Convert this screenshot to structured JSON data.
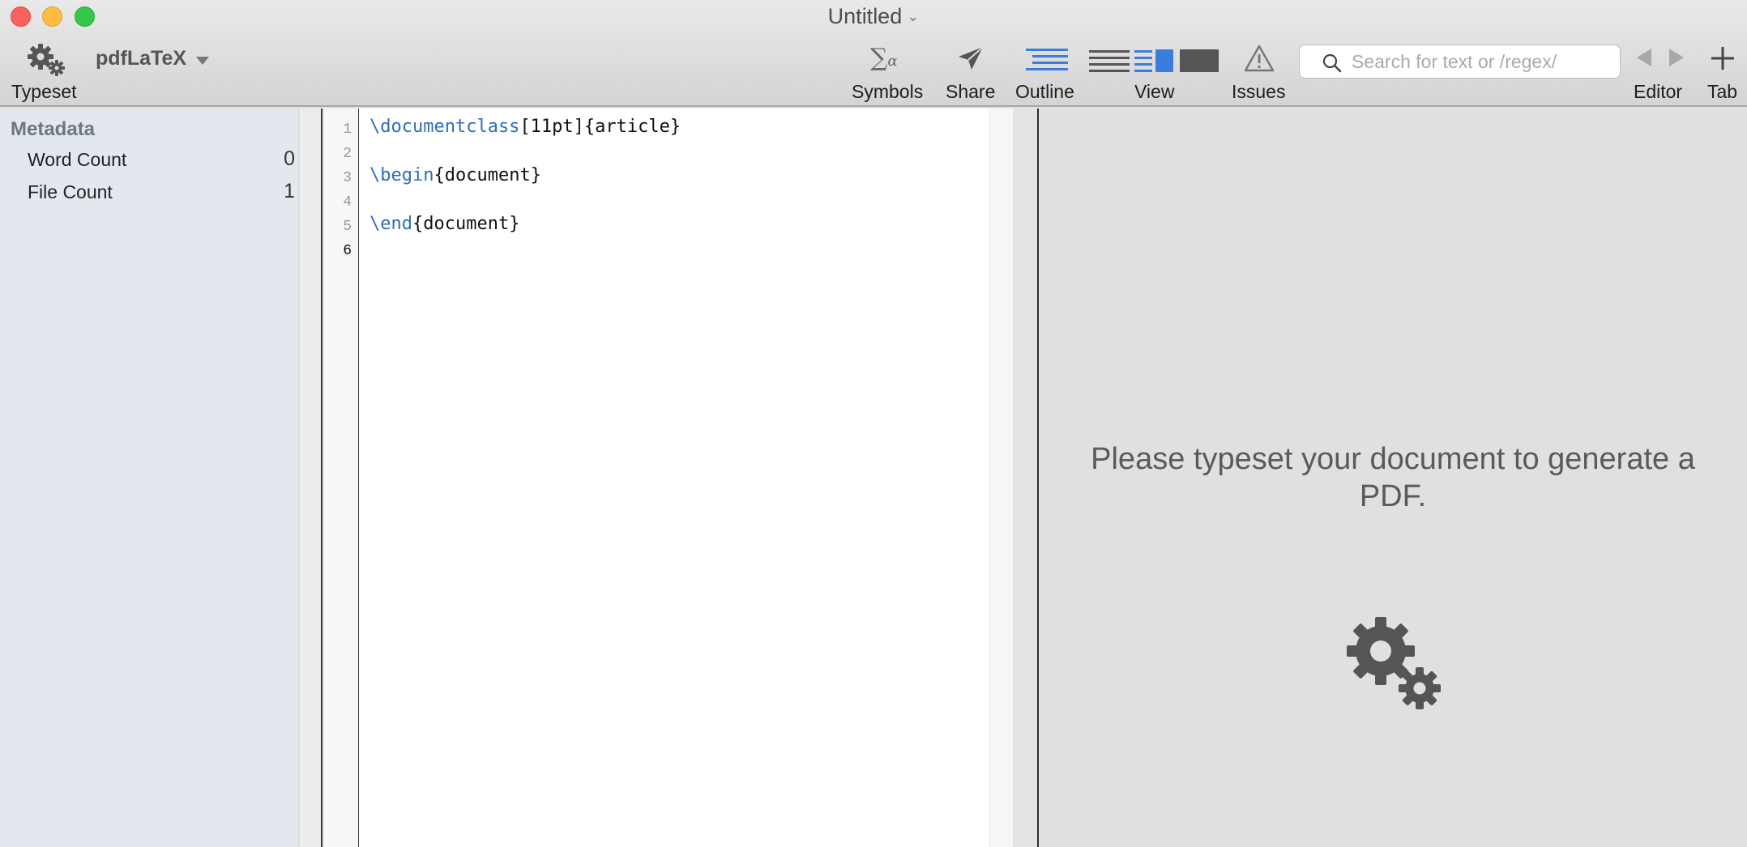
{
  "window": {
    "title": "Untitled"
  },
  "toolbar": {
    "typeset_label": "Typeset",
    "engine": "pdfLaTeX",
    "symbols_label": "Symbols",
    "share_label": "Share",
    "outline_label": "Outline",
    "view_label": "View",
    "issues_label": "Issues",
    "search_placeholder": "Search for text or /regex/",
    "editor_label": "Editor",
    "tab_label": "Tab",
    "accent_color": "#3b7ddd"
  },
  "sidebar": {
    "header": "Metadata",
    "rows": [
      {
        "label": "Word Count",
        "value": "0"
      },
      {
        "label": "File Count",
        "value": "1"
      }
    ]
  },
  "editor": {
    "line_numbers": [
      "1",
      "2",
      "3",
      "4",
      "5",
      "6"
    ],
    "current_line": "6",
    "lines": [
      {
        "cmd": "\\documentclass",
        "rest": "[11pt]{article}"
      },
      {
        "cmd": "",
        "rest": ""
      },
      {
        "cmd": "\\begin",
        "rest": "{document}"
      },
      {
        "cmd": "",
        "rest": ""
      },
      {
        "cmd": "\\end",
        "rest": "{document}"
      },
      {
        "cmd": "",
        "rest": ""
      }
    ],
    "keyword_color": "#2f6db8"
  },
  "preview": {
    "message": "Please typeset your document to generate a PDF."
  }
}
